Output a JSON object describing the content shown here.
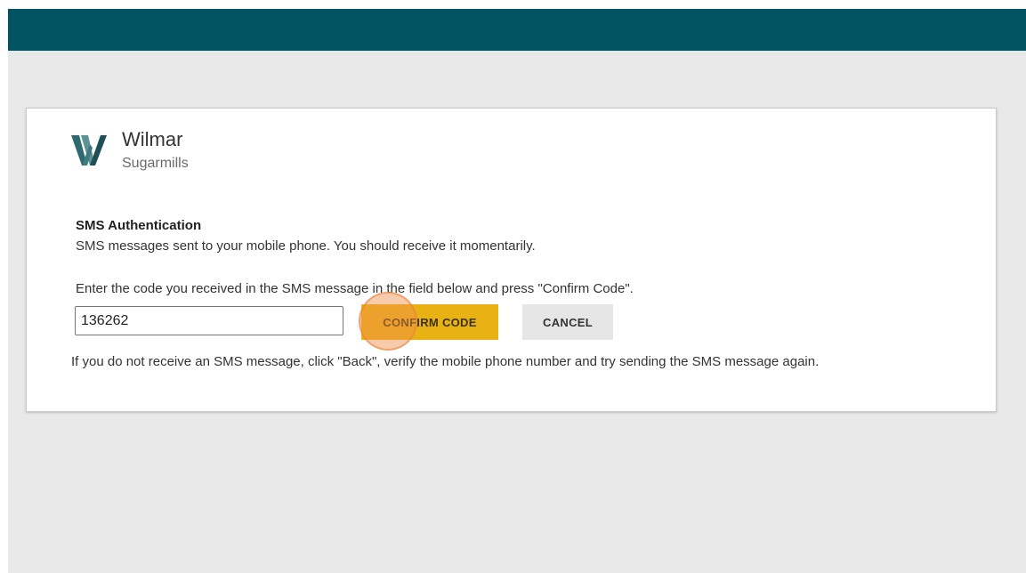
{
  "brand": {
    "name": "Wilmar",
    "subtitle": "Sugarmills"
  },
  "auth": {
    "title": "SMS Authentication",
    "info": "SMS messages sent to your mobile phone. You should receive it momentarily.",
    "instruction": "Enter the code you received in the SMS message in the field below and press \"Confirm Code\".",
    "code_value": "136262",
    "confirm_label": "CONFIRM CODE",
    "cancel_label": "CANCEL",
    "help": "If you do not receive an SMS message, click \"Back\", verify the mobile phone number and try sending the SMS message again."
  },
  "colors": {
    "header": "#005360",
    "confirm_button": "#e8b215",
    "cancel_button": "#e6e6e6",
    "page_background": "#e9e9e9"
  },
  "icons": {
    "logo": "wilmar-w-logo-icon"
  }
}
